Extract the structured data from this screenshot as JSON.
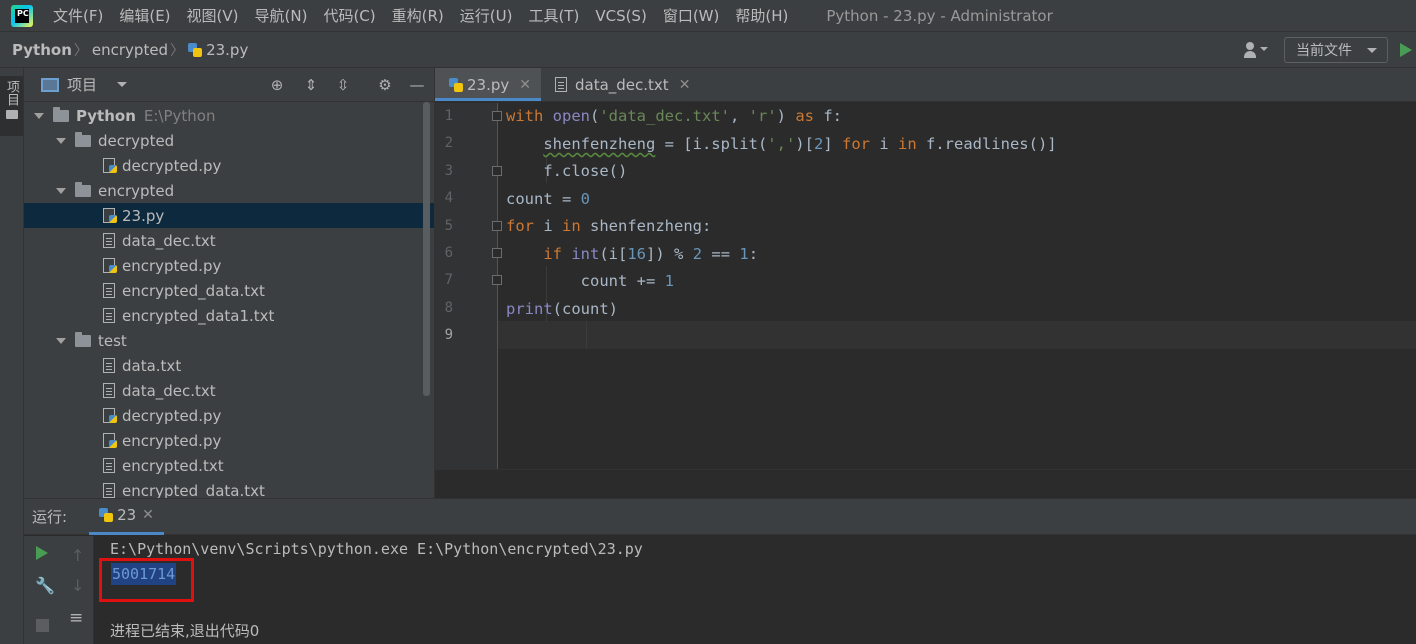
{
  "menubar": {
    "logo": "PC",
    "items": [
      "文件(F)",
      "编辑(E)",
      "视图(V)",
      "导航(N)",
      "代码(C)",
      "重构(R)",
      "运行(U)",
      "工具(T)",
      "VCS(S)",
      "窗口(W)",
      "帮助(H)"
    ],
    "window_title": "Python - 23.py - Administrator"
  },
  "navbar": {
    "crumbs": [
      "Python",
      "encrypted",
      "23.py"
    ],
    "run_config": "当前文件"
  },
  "left_strip": {
    "project_label": "项目"
  },
  "project_panel": {
    "title": "项目",
    "tree": [
      {
        "label": "Python",
        "hint": "E:\\Python",
        "type": "folder",
        "depth": 0,
        "expanded": true,
        "bold": true
      },
      {
        "label": "decrypted",
        "type": "folder",
        "depth": 1,
        "expanded": true
      },
      {
        "label": "decrypted.py",
        "type": "py",
        "depth": 2
      },
      {
        "label": "encrypted",
        "type": "folder",
        "depth": 1,
        "expanded": true
      },
      {
        "label": "23.py",
        "type": "py",
        "depth": 2,
        "selected": true
      },
      {
        "label": "data_dec.txt",
        "type": "txt",
        "depth": 2
      },
      {
        "label": "encrypted.py",
        "type": "py",
        "depth": 2
      },
      {
        "label": "encrypted_data.txt",
        "type": "txt",
        "depth": 2
      },
      {
        "label": "encrypted_data1.txt",
        "type": "txt",
        "depth": 2
      },
      {
        "label": "test",
        "type": "folder",
        "depth": 1,
        "expanded": true
      },
      {
        "label": "data.txt",
        "type": "txt",
        "depth": 2
      },
      {
        "label": "data_dec.txt",
        "type": "txt",
        "depth": 2
      },
      {
        "label": "decrypted.py",
        "type": "py",
        "depth": 2
      },
      {
        "label": "encrypted.py",
        "type": "py",
        "depth": 2
      },
      {
        "label": "encrypted.txt",
        "type": "txt",
        "depth": 2
      },
      {
        "label": "encrypted_data.txt",
        "type": "txt",
        "depth": 2
      }
    ]
  },
  "editor": {
    "tabs": [
      {
        "label": "23.py",
        "active": true
      },
      {
        "label": "data_dec.txt",
        "active": false
      }
    ],
    "line_numbers": [
      "1",
      "2",
      "3",
      "4",
      "5",
      "6",
      "7",
      "8",
      "9"
    ],
    "code_lines": [
      "with open('data_dec.txt', 'r') as f:",
      "    shenfenzheng = [i.split(',')[2] for i in f.readlines()]",
      "    f.close()",
      "count = 0",
      "for i in shenfenzheng:",
      "    if int(i[16]) % 2 == 1:",
      "        count += 1",
      "print(count)",
      ""
    ]
  },
  "run_panel": {
    "label": "运行:",
    "tab": "23",
    "command": "E:\\Python\\venv\\Scripts\\python.exe E:\\Python\\encrypted\\23.py",
    "output": "5001714",
    "exit_message": "进程已结束,退出代码0"
  }
}
